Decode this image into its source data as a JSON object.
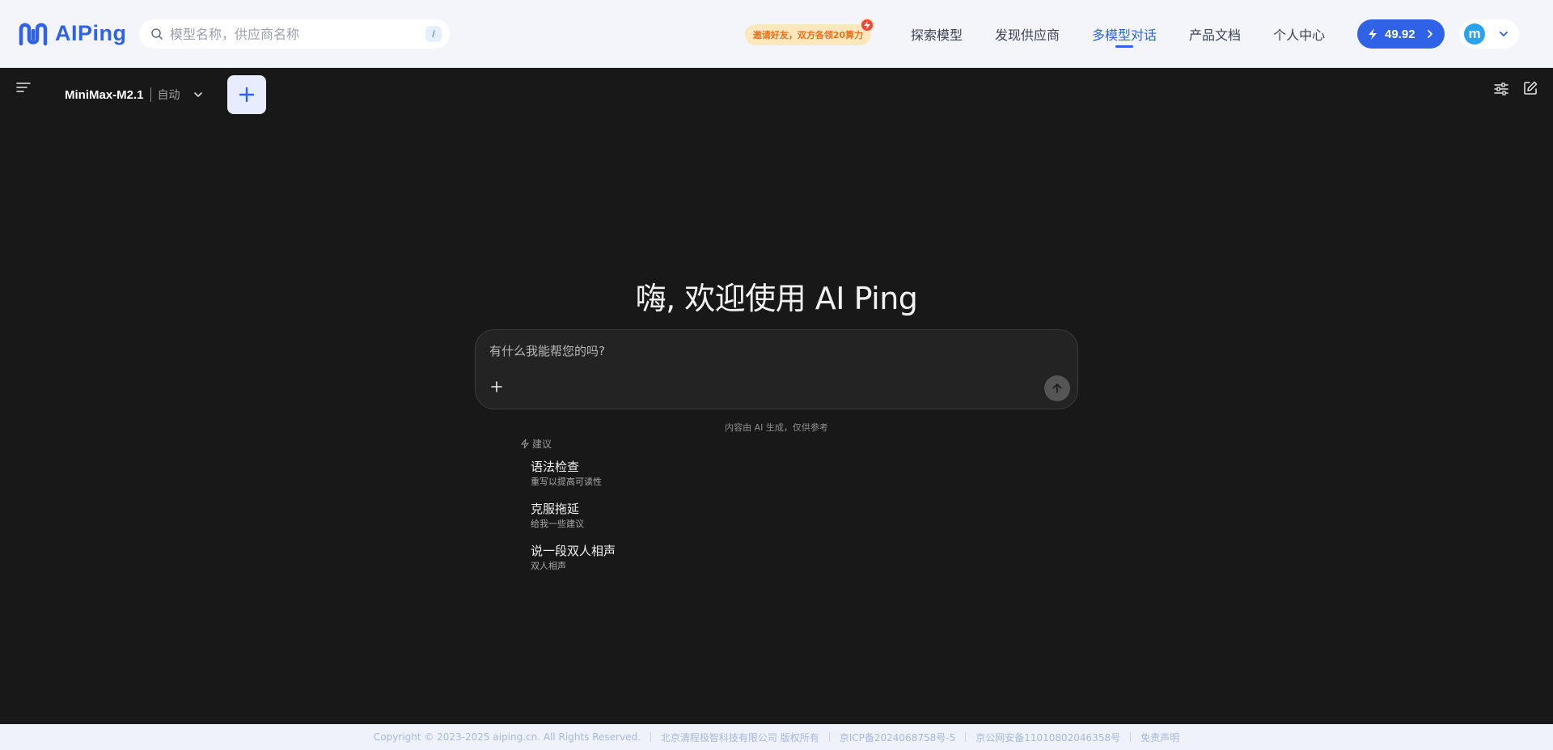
{
  "header": {
    "logo_text": "AIPing",
    "search_placeholder": "模型名称，供应商名称",
    "search_shortcut": "/",
    "invite_text": "邀请好友，双方各领20算力",
    "nav": [
      {
        "label": "探索模型"
      },
      {
        "label": "发现供应商"
      },
      {
        "label": "多模型对话",
        "active": true
      },
      {
        "label": "产品文档"
      },
      {
        "label": "个人中心"
      }
    ],
    "balance": "49.92",
    "avatar_letter": "m"
  },
  "toolbar": {
    "model_name": "MiniMax-M2.1",
    "model_mode": "自动"
  },
  "main": {
    "welcome": "嗨, 欢迎使用 AI Ping",
    "input_placeholder": "有什么我能帮您的吗?",
    "disclaimer": "内容由 AI 生成，仅供参考",
    "suggest_heading": "建议",
    "suggestions": [
      {
        "title": "语法检查",
        "subtitle": "重写以提高可读性"
      },
      {
        "title": "克服拖延",
        "subtitle": "给我一些建议"
      },
      {
        "title": "说一段双人相声",
        "subtitle": "双人相声"
      }
    ]
  },
  "footer": {
    "copyright": "Copyright © 2023-2025 aiping.cn. All Rights Reserved.",
    "company": "北京清程极智科技有限公司 版权所有",
    "icp": "京ICP备2024068758号-5",
    "police": "京公网安备11010802046358号",
    "disclaimer_link": "免责声明"
  },
  "colors": {
    "brand": "#2f62e6",
    "background": "#181818",
    "header_bg": "#f3f5fa",
    "invite_bg": "#fde7bd",
    "invite_text": "#e9711c"
  },
  "icons": [
    "logo-icon",
    "search-icon",
    "lightning-icon",
    "chevron-right-icon",
    "chevron-down-icon",
    "menu-icon",
    "plus-icon",
    "tune-icon",
    "edit-icon",
    "arrow-up-icon",
    "sparkle-icon"
  ]
}
